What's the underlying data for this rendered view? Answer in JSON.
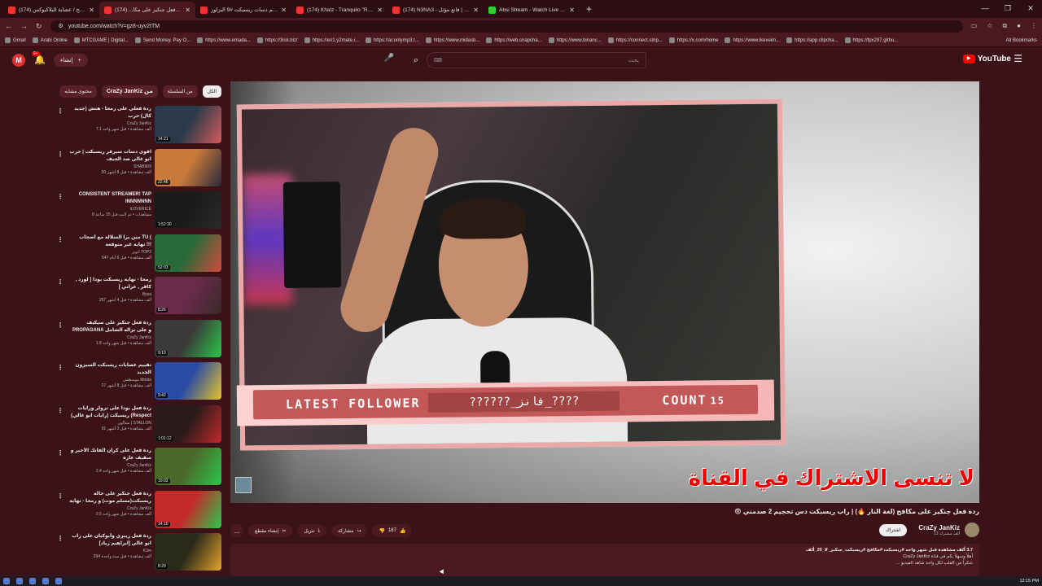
{
  "browser": {
    "tabs": [
      {
        "title": "مكافح / عصابة البلاكبوكس (174)",
        "color": "#e33",
        "active": false
      },
      {
        "title": "ردة فعل جنكيز على مكا... (174)",
        "color": "#e33",
        "active": true
      },
      {
        "title": "تقييم دسات ريسيكت #9 البزلوز",
        "color": "#e33",
        "active": false
      },
      {
        "title": "(174) Khalz - Tranquilo \"Rema...",
        "color": "#e33",
        "active": false
      },
      {
        "title": "(174) N3NA3 - قانع مؤثل | Offi...",
        "color": "#e33",
        "active": false
      },
      {
        "title": "Absi Stream - Watch Live on Ki...",
        "color": "#3c3",
        "active": false
      }
    ],
    "new_tab": "+",
    "url": "youtube.com/watch?v=gz8-uyv2tTM",
    "bookmarks": [
      "Gmail",
      "Arabi Online",
      "MTCGAME | Digital...",
      "Send Money, Pay O...",
      "https://www.emada...",
      "https://3isk.biz/",
      "https://en1.y2mate.i...",
      "https://ar.onlymp3.t...",
      "https://www.midasb...",
      "https://web.snapcha...",
      "https://www.binanc...",
      "https://connect.strip...",
      "https://x.com/home",
      "https://www.ikeveim...",
      "https://app.clipcha...",
      "https://fpx297.githu..."
    ],
    "all_bookmarks": "All Bookmarks"
  },
  "youtube": {
    "avatar_letter": "M",
    "notif_badge": "9+",
    "create_label": "إنشاء",
    "search_placeholder": "بحث",
    "logo_text": "YouTube",
    "chips": [
      "الكل",
      "من السلسلة",
      "CraZy JanKiz من",
      "محتوى مشابه"
    ],
    "recommendations": [
      {
        "title": "ردة فعلي على رمحا - هتش (جديد كال) حرب",
        "channel": "CraZy JanKiz",
        "views": "7.1 ألف مشاهدة • قبل شهر واحد",
        "duration": "14:21",
        "c1": "#2a3a4a",
        "c2": "#d45a5a"
      },
      {
        "title": "اقوى دسات سيرفر ريسبكت | حرب ابو غالي ضد الجيف",
        "channel": "SHAB909",
        "views": "50 ألف مشاهدة • قبل 8 أشهر",
        "duration": "22:46",
        "c1": "#c87a3a",
        "c2": "#2a2a3a"
      },
      {
        "title": "CONSISTENT STREAMER! TAP INNNNNNN",
        "channel": "iLOVERICE",
        "views": "8 مشاهدات • تم البث قبل 15 ساعة",
        "duration": "1:52:30",
        "c1": "#1a1a1a",
        "c2": "#2a2a2a"
      },
      {
        "title": "مين يرا السلالة مع أصحاب TU ( نهاية غير متوقعة !!!",
        "channel": "اتوبز TOP2",
        "views": "547 ألف مشاهدة • قبل 6 أيام",
        "duration": "52:03",
        "c1": "#2a6a3a",
        "c2": "#d44a3a"
      },
      {
        "title": "رمحا - نهاية ريسبكت بودا [ لورد , كاقر , عراني ]",
        "channel": "Bssa",
        "views": "257 ألف مشاهدة • قبل 4 أشهر",
        "duration": "8:26",
        "c1": "#6a2a4a",
        "c2": "#3a2a2a"
      },
      {
        "title": "ردة فعل جنكيز على سيكيف PROPAGANA و على نزاله الشامل",
        "channel": "CraZy JanKiz",
        "views": "1.8 ألف مشاهدة • قبل شهر واحد",
        "duration": "9:19",
        "c1": "#3a3a3a",
        "c2": "#2ac84a"
      },
      {
        "title": "تقييم عصابات ريسبكت السيزون الجديد",
        "channel": "موسطش Mosta",
        "views": "27 ألف مشاهدة • قبل 8 أشهر",
        "duration": "9:42",
        "c1": "#2a4aa4",
        "c2": "#e4c42a"
      },
      {
        "title": "ردة فعل بودا على ترولر ورايات ريسبكت (رايات ابو غالي) (Respect",
        "channel": "ستالون | STALLON",
        "views": "91 ألف مشاهدة • قبل 3 أشهر",
        "duration": "1:01:12",
        "c1": "#2a1a1a",
        "c2": "#c42a2a"
      },
      {
        "title": "ردة فعل على كران الفانك الأخير و سقيف عاره",
        "channel": "CraZy JanKiz",
        "views": "2.4 ألف مشاهدة • قبل شهر واحد",
        "duration": "10:02",
        "c1": "#4a6a2a",
        "c2": "#2ac84a"
      },
      {
        "title": "ردة فعل جنكيز على حالة ريسبكت(مسلم موت) و رمحا - نهاية ريسبكت",
        "channel": "CraZy JanKiz",
        "views": "2.5 ألف مشاهدة • قبل شهر واحد",
        "duration": "14:10",
        "c1": "#c42a2a",
        "c2": "#2ac84a"
      },
      {
        "title": "ردة فعل ريبزي وأبوكيان على راب ابو غالي [ابراهيم زياد]",
        "channel": "K3m",
        "views": "294 ألف مشاهدة • قبل سنة واحدة",
        "duration": "8:29",
        "c1": "#2a2a1a",
        "c2": "#e4a42a"
      }
    ],
    "player": {
      "follower_label": "LATEST FOLLOWER",
      "follower_name": "??????_فانز_????",
      "count_label": "COUNT",
      "count_value": "15",
      "subscribe_banner": "لا تنسى الاشتراك في القناة"
    },
    "video_title": "ردة فعل جنكيز على مكافح (لغة النار 🔥) | راب ريسبكت دس تحجيم 2 صدمني 😨",
    "owner": {
      "name": "CraZy JanKiz",
      "subs": "13 ألف مشترك",
      "subscribe": "اشتراك"
    },
    "likes": "187",
    "share": "مشاركة",
    "download": "تنزيل",
    "clip": "إنشاء مقطع",
    "more": "...",
    "description": {
      "stats": "3.7 ألف مشاهدة قبل شهر واحد  #ريسبكت #مكافح #ريسبكت_جنكيز_لا_20_ألف",
      "line2": "أهلاً وسهلاً بكم في قناة CraZy JanKiz",
      "line3": "شكراً من القلب لكل واحد شاهد الفيديو ..."
    }
  },
  "taskbar": {
    "time": "12:15 PM"
  }
}
